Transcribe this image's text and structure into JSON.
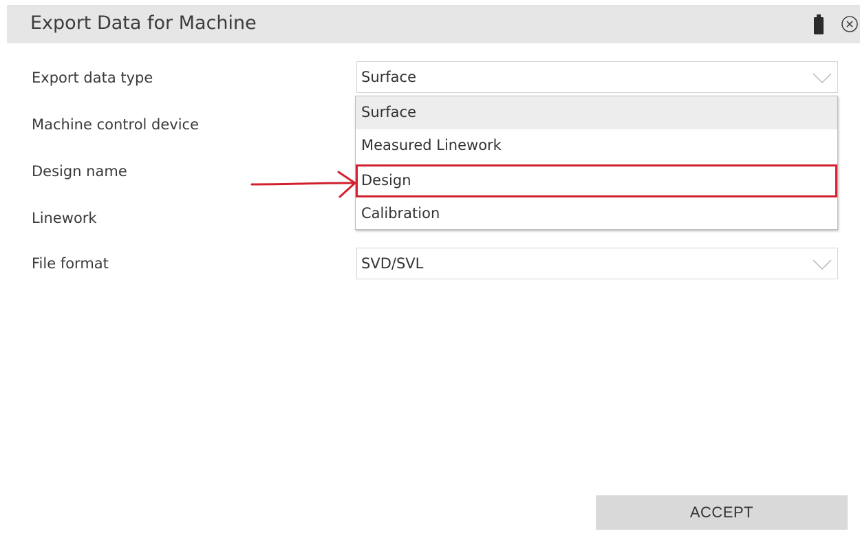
{
  "window": {
    "title": "Export Data for Machine",
    "icons": {
      "battery": "battery-icon",
      "close": "close-icon"
    }
  },
  "form": {
    "fields": [
      {
        "label": "Export data type",
        "value": "Surface"
      },
      {
        "label": "Machine control device",
        "value": ""
      },
      {
        "label": "Design name",
        "value": ""
      },
      {
        "label": "Linework",
        "value": ""
      },
      {
        "label": "File format",
        "value": "SVD/SVL"
      }
    ]
  },
  "dropdown": {
    "options": [
      "Surface",
      "Measured Linework",
      "Design",
      "Calibration"
    ],
    "selected": "Surface",
    "highlighted": "Design"
  },
  "annotation": {
    "color": "#d2202f",
    "target": "Design"
  },
  "footer": {
    "accept_label": "ACCEPT"
  }
}
